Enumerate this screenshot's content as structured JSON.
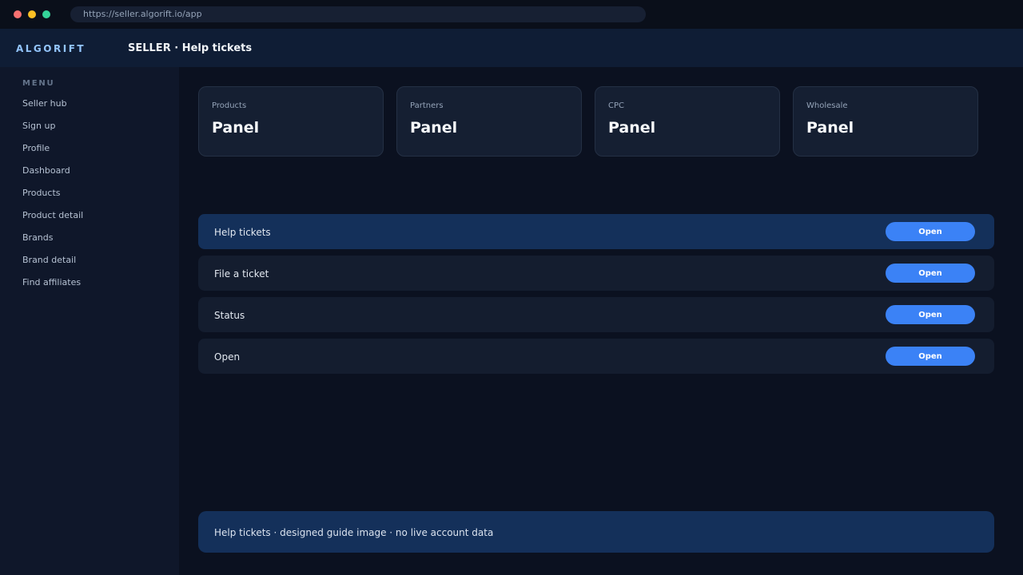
{
  "browser": {
    "url": "https://seller.algorift.io/app"
  },
  "header": {
    "brand": "ALGORIFT",
    "title": "SELLER · Help tickets"
  },
  "sidebar": {
    "menu_label": "MENU",
    "items": [
      {
        "label": "Seller hub"
      },
      {
        "label": "Sign up"
      },
      {
        "label": "Profile"
      },
      {
        "label": "Dashboard"
      },
      {
        "label": "Products"
      },
      {
        "label": "Product detail"
      },
      {
        "label": "Brands"
      },
      {
        "label": "Brand detail"
      },
      {
        "label": "Find affiliates"
      }
    ]
  },
  "cards": [
    {
      "label": "Products",
      "value": "Panel"
    },
    {
      "label": "Partners",
      "value": "Panel"
    },
    {
      "label": "CPC",
      "value": "Panel"
    },
    {
      "label": "Wholesale",
      "value": "Panel"
    }
  ],
  "rows": [
    {
      "label": "Help tickets",
      "button": "Open",
      "active": true
    },
    {
      "label": "File a ticket",
      "button": "Open",
      "active": false
    },
    {
      "label": "Status",
      "button": "Open",
      "active": false
    },
    {
      "label": "Open",
      "button": "Open",
      "active": false
    }
  ],
  "footer": {
    "note": "Help tickets · designed guide image · no live account data"
  },
  "colors": {
    "background": "#0b1120",
    "header": "#0f1d35",
    "sidebar": "#0f172a",
    "card": "#151f32",
    "active_row": "#14305a",
    "accent": "#3b82f6",
    "brand": "#93c5fd"
  }
}
